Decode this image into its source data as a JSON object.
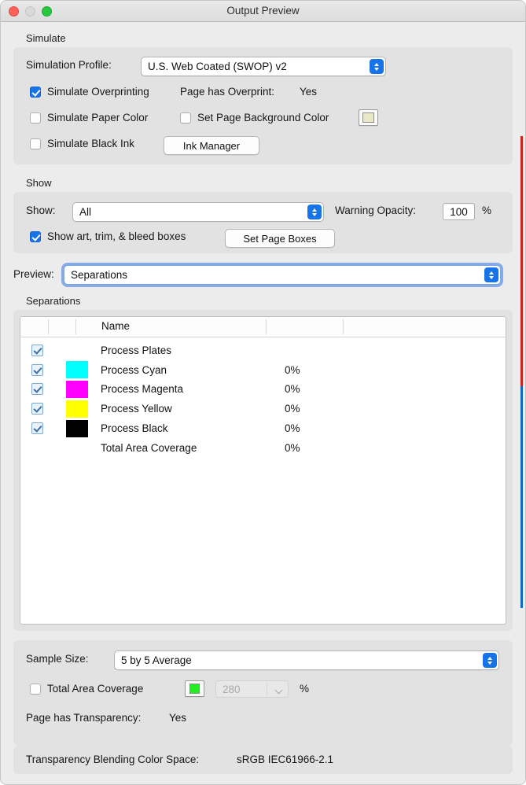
{
  "window": {
    "title": "Output Preview",
    "traffic_lights": [
      "close-button",
      "minimize-button",
      "zoom-button"
    ]
  },
  "simulate": {
    "group_label": "Simulate",
    "profile_label": "Simulation Profile:",
    "profile_value": "U.S. Web Coated (SWOP) v2",
    "simulate_overprinting_label": "Simulate Overprinting",
    "simulate_overprinting_checked": true,
    "page_has_overprint_label": "Page has Overprint:",
    "page_has_overprint_value": "Yes",
    "simulate_paper_color_label": "Simulate Paper Color",
    "simulate_paper_color_checked": false,
    "set_page_background_color_label": "Set Page Background Color",
    "set_page_background_color_checked": false,
    "page_background_swatch_color": "#e8e8c8",
    "simulate_black_ink_label": "Simulate Black Ink",
    "simulate_black_ink_checked": false,
    "ink_manager_label": "Ink Manager"
  },
  "show": {
    "group_label": "Show",
    "show_label": "Show:",
    "show_value": "All",
    "warning_opacity_label": "Warning Opacity:",
    "warning_opacity_value": "100",
    "warning_opacity_unit": "%",
    "show_boxes_label": "Show art, trim, & bleed boxes",
    "show_boxes_checked": true,
    "set_page_boxes_label": "Set Page Boxes"
  },
  "preview": {
    "label": "Preview:",
    "value": "Separations",
    "focused": true
  },
  "separations": {
    "group_label": "Separations",
    "columns": [
      "",
      "",
      "Name",
      "",
      ""
    ],
    "rows": [
      {
        "checked": true,
        "swatch": null,
        "name": "Process Plates",
        "percent": ""
      },
      {
        "checked": true,
        "swatch": "#00ffff",
        "name": "Process Cyan",
        "percent": "0%"
      },
      {
        "checked": true,
        "swatch": "#ff00ff",
        "name": "Process Magenta",
        "percent": "0%"
      },
      {
        "checked": true,
        "swatch": "#ffff00",
        "name": "Process Yellow",
        "percent": "0%"
      },
      {
        "checked": true,
        "swatch": "#000000",
        "name": "Process Black",
        "percent": "0%"
      },
      {
        "checked": null,
        "swatch": null,
        "name": "Total Area Coverage",
        "percent": "0%"
      }
    ]
  },
  "footer": {
    "sample_size_label": "Sample Size:",
    "sample_size_value": "5 by 5 Average",
    "total_area_coverage_label": "Total Area Coverage",
    "total_area_coverage_checked": false,
    "total_area_coverage_swatch": "#22ee22",
    "total_area_coverage_value": "280",
    "total_area_coverage_unit": "%",
    "page_has_transparency_label": "Page has Transparency:",
    "page_has_transparency_value": "Yes",
    "blending_space_label": "Transparency Blending Color Space:",
    "blending_space_value": "sRGB IEC61966-2.1"
  },
  "accents": {
    "control_blue": "#1673e8",
    "focus_ring": "#6f9fe0",
    "edge_marker_red": "#d0211c",
    "edge_marker_blue": "#1069c0"
  }
}
